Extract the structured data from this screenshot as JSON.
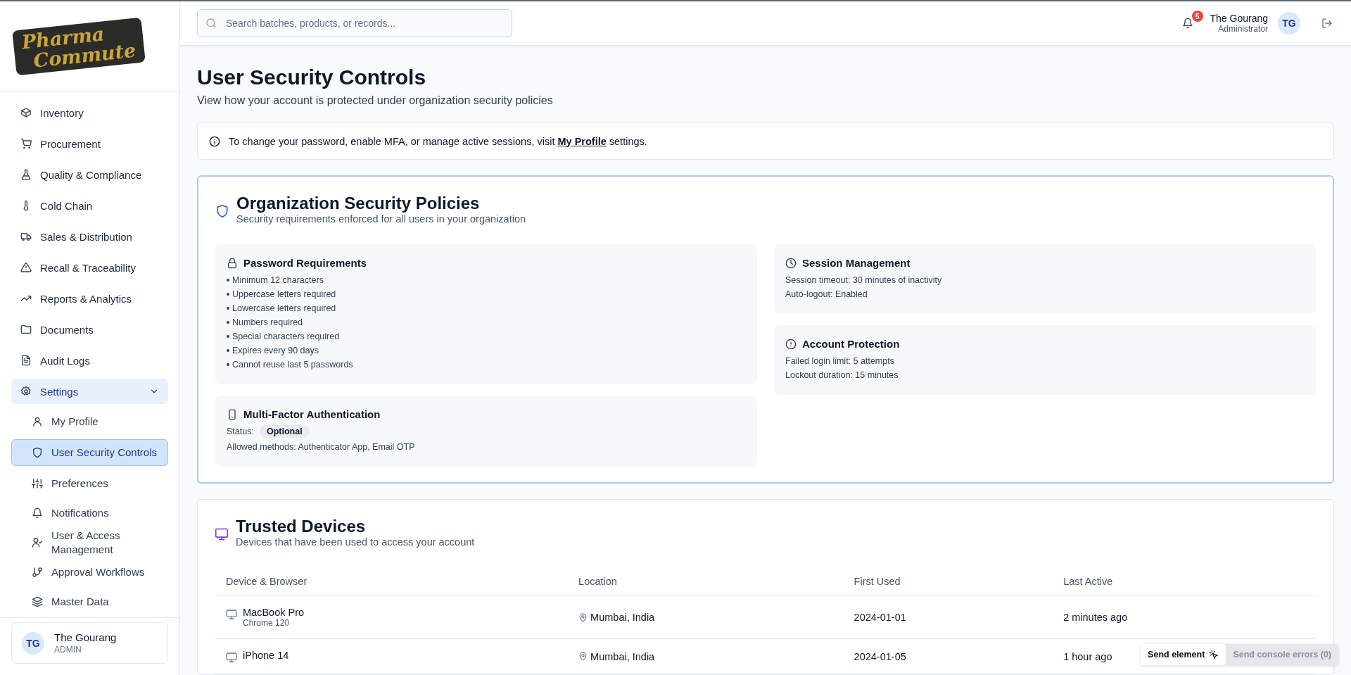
{
  "logo": {
    "line_1": "Pharma",
    "line_2": "Commute"
  },
  "sidebar": {
    "items": [
      {
        "kind": "link",
        "label": "Inventory",
        "selected": false
      },
      {
        "kind": "link",
        "label": "Procurement",
        "selected": false
      },
      {
        "kind": "link",
        "label": "Quality & Compliance",
        "selected": false
      },
      {
        "kind": "link",
        "label": "Cold Chain",
        "selected": false
      },
      {
        "kind": "link",
        "label": "Sales & Distribution",
        "selected": false
      },
      {
        "kind": "link",
        "label": "Recall & Traceability",
        "selected": false
      },
      {
        "kind": "link",
        "label": "Reports & Analytics",
        "selected": false
      },
      {
        "kind": "link",
        "label": "Documents",
        "selected": false
      },
      {
        "kind": "link",
        "label": "Audit Logs",
        "selected": false
      },
      {
        "kind": "group",
        "label": "Settings",
        "selected": false,
        "expanded": true,
        "children": [
          {
            "label": "My Profile",
            "selected": false
          },
          {
            "label": "User Security Controls",
            "selected": true
          },
          {
            "label": "Preferences",
            "selected": false
          },
          {
            "label": "Notifications",
            "selected": false
          },
          {
            "label": "User & Access Management",
            "selected": false
          },
          {
            "label": "Approval Workflows",
            "selected": false
          },
          {
            "label": "Master Data",
            "selected": false
          }
        ]
      }
    ],
    "user": {
      "initials": "TG",
      "name": "The Gourang",
      "role": "ADMIN"
    }
  },
  "header": {
    "search": {
      "placeholder": "Search batches, products, or records..."
    },
    "notifications": "5",
    "user": {
      "name": "The Gourang",
      "role": "Administrator",
      "initials": "TG"
    }
  },
  "page": {
    "title": "User Security Controls",
    "subtitle": "View how your account is protected under organization security policies"
  },
  "info": {
    "text_before": "To change your password, enable MFA, or manage active sessions, visit",
    "link": "My Profile",
    "text_after": "settings."
  },
  "policies": {
    "title": "Organization Security Policies",
    "subtitle": "Security requirements enforced for all users in your organization",
    "columns": [
      [
        {
          "kind": "list",
          "title": "Password Requirements",
          "items": [
            "Minimum 12 characters",
            "Uppercase letters required",
            "Lowercase letters required",
            "Numbers required",
            "Special characters required",
            "Expires every 90 days",
            "Cannot reuse last 5 passwords"
          ]
        },
        {
          "kind": "status",
          "title": "Multi-Factor Authentication",
          "status_label": "Status:",
          "status": "Optional",
          "lines": [
            "Allowed methods: Authenticator App, Email OTP"
          ]
        }
      ],
      [
        {
          "kind": "lines",
          "title": "Session Management",
          "lines": [
            "Session timeout: 30 minutes of inactivity",
            "Auto-logout: Enabled"
          ]
        },
        {
          "kind": "lines",
          "title": "Account Protection",
          "lines": [
            "Failed login limit: 5 attempts",
            "Lockout duration: 15 minutes"
          ]
        }
      ]
    ]
  },
  "devices": {
    "title": "Trusted Devices",
    "subtitle": "Devices that have been used to access your account",
    "columns": [
      "Device & Browser",
      "Location",
      "First Used",
      "Last Active"
    ],
    "rows": [
      {
        "device": "MacBook Pro",
        "browser": "Chrome 120",
        "location": "Mumbai, India",
        "first_used": "2024-01-01",
        "last_active": "2 minutes ago"
      },
      {
        "device": "iPhone 14",
        "location": "Mumbai, India",
        "first_used": "2024-01-05",
        "last_active": "1 hour ago"
      }
    ]
  },
  "dev_tools": {
    "buttons": [
      {
        "label": "Send element",
        "disabled": false
      },
      {
        "label": "Send console errors (0)",
        "disabled": true
      }
    ]
  }
}
